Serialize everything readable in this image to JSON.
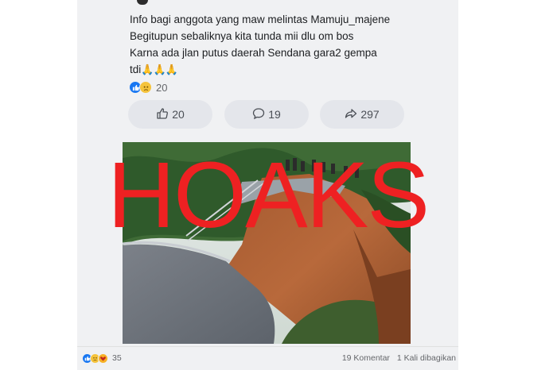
{
  "post": {
    "lines": [
      "Info bagi anggota yang maw melintas Mamuju_majene",
      "Begitupun sebaliknya kita tunda mii dlu om bos",
      "Karna ada jlan putus daerah Sendana gara2 gempa"
    ],
    "last_line_text": "tdi",
    "last_line_emoji": "🙏🙏🙏",
    "reaction_count": "20"
  },
  "actions": {
    "like_count": "20",
    "comment_count": "19",
    "share_count": "297"
  },
  "overlay": {
    "stamp": "HOAKS",
    "stamp_color": "#ee2122"
  },
  "footer": {
    "reaction_count": "35",
    "comments": "19 Komentar",
    "shares": "1 Kali dibagikan"
  },
  "colors": {
    "like_blue": "#1877f2",
    "pill_bg": "#e4e6eb",
    "card_bg": "#f0f1f3"
  }
}
